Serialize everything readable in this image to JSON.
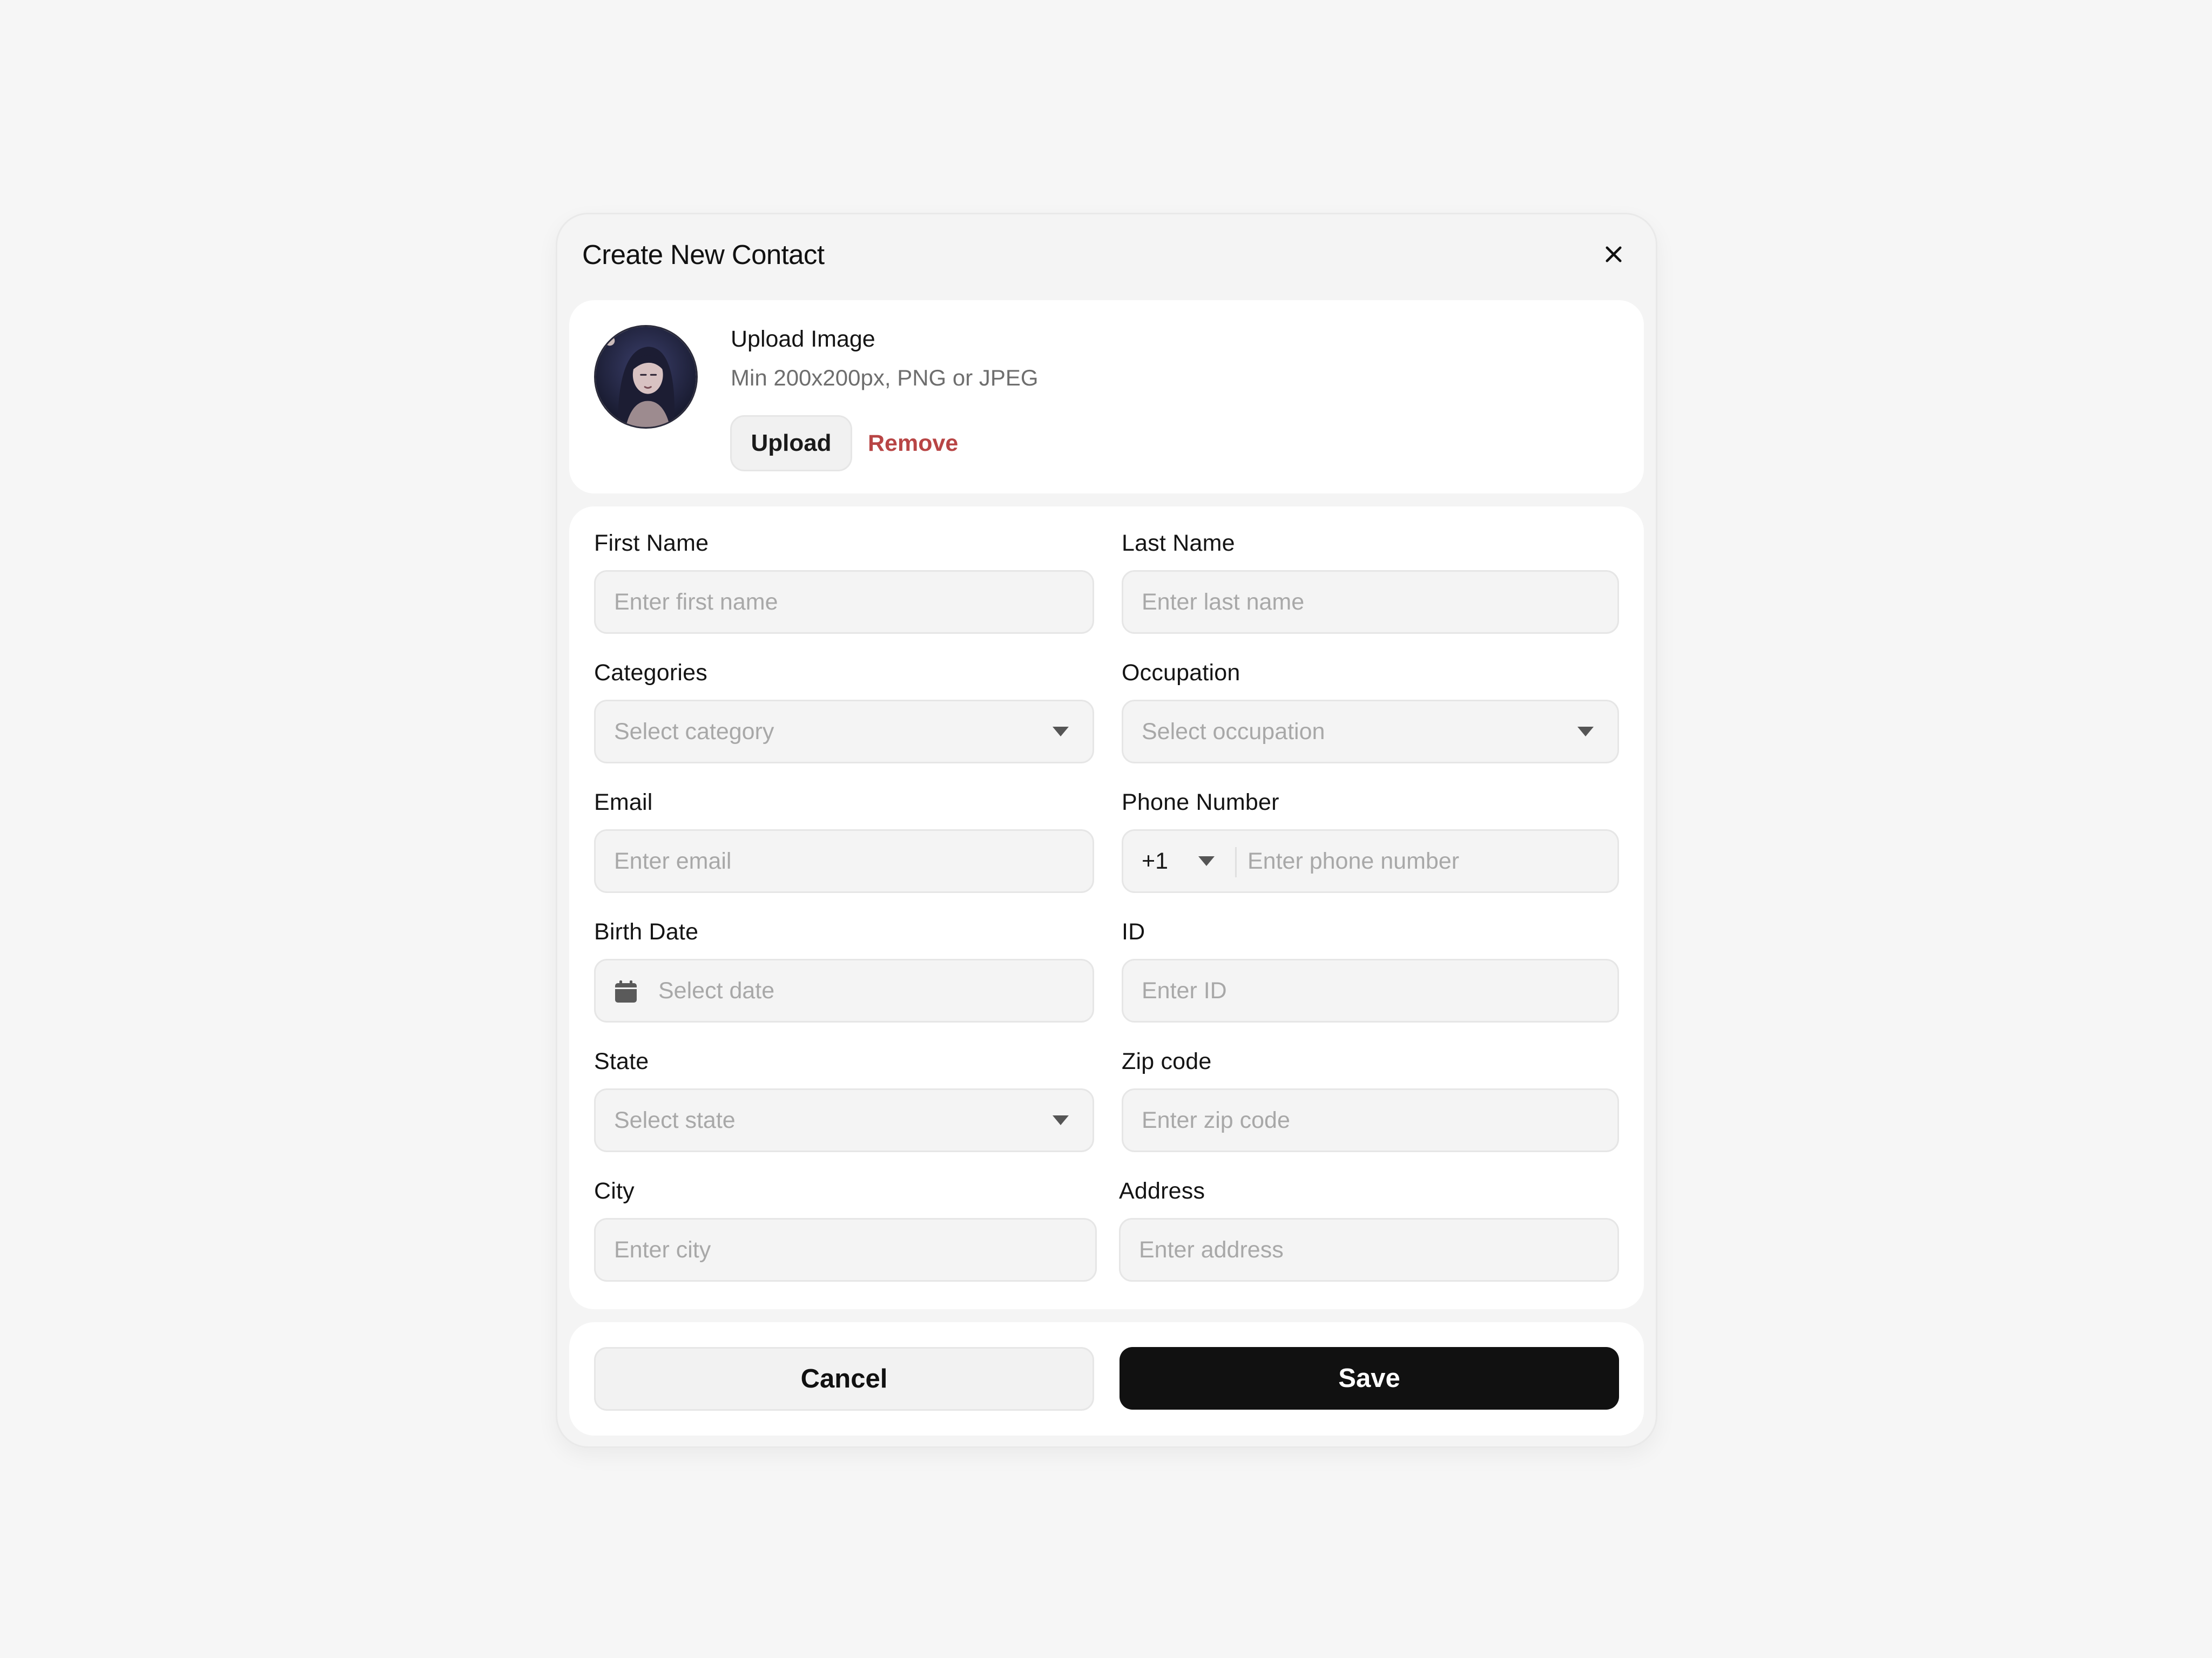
{
  "modal": {
    "title": "Create New Contact",
    "close_icon": "close-icon"
  },
  "upload": {
    "title": "Upload Image",
    "hint": "Min 200x200px, PNG or JPEG",
    "upload_label": "Upload",
    "remove_label": "Remove",
    "avatar": "avatar-illustration"
  },
  "form": {
    "first_name": {
      "label": "First Name",
      "placeholder": "Enter first name"
    },
    "last_name": {
      "label": "Last Name",
      "placeholder": "Enter last name"
    },
    "categories": {
      "label": "Categories",
      "placeholder": "Select category",
      "icon": "chevron-down-icon"
    },
    "occupation": {
      "label": "Occupation",
      "placeholder": "Select occupation",
      "icon": "chevron-down-icon"
    },
    "email": {
      "label": "Email",
      "placeholder": "Enter email"
    },
    "phone": {
      "label": "Phone Number",
      "country_code": "+1",
      "placeholder": "Enter phone number",
      "icon": "chevron-down-icon"
    },
    "birth_date": {
      "label": "Birth Date",
      "placeholder": "Select date",
      "icon": "calendar-icon"
    },
    "id": {
      "label": "ID",
      "placeholder": "Enter ID"
    },
    "state": {
      "label": "State",
      "placeholder": "Select state",
      "icon": "chevron-down-icon"
    },
    "zip": {
      "label": "Zip code",
      "placeholder": "Enter zip code"
    },
    "city": {
      "label": "City",
      "placeholder": "Enter city"
    },
    "address": {
      "label": "Address",
      "placeholder": "Enter address"
    }
  },
  "footer": {
    "cancel_label": "Cancel",
    "save_label": "Save"
  },
  "colors": {
    "page_background": "#f6f6f6",
    "primary_button": "#111111",
    "remove_link": "#b84545",
    "placeholder_text": "#a8a8a8"
  }
}
